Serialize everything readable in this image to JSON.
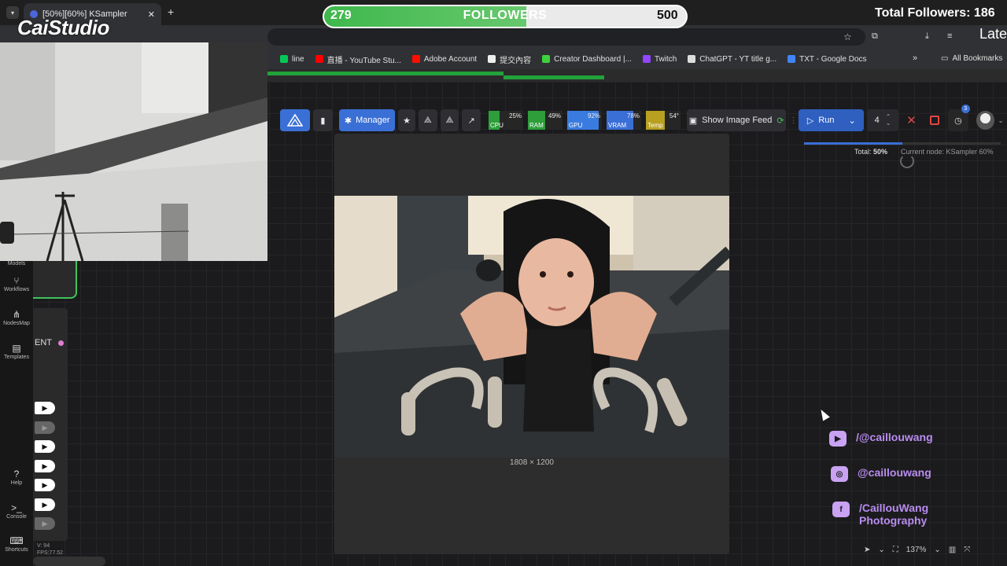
{
  "browser": {
    "tab_title": "[50%][60%] KSampler",
    "new_tab": "+",
    "close_tab": "✕",
    "bookmarks": [
      {
        "label": "line",
        "color": "#06c755"
      },
      {
        "label": "直播 - YouTube Stu...",
        "color": "#ff0000"
      },
      {
        "label": "Adobe Account",
        "color": "#fa0f00"
      },
      {
        "label": "提交內容",
        "color": "#eeeeee"
      },
      {
        "label": "Creator Dashboard |...",
        "color": "#3ed13e"
      },
      {
        "label": "Twitch",
        "color": "#9146ff"
      },
      {
        "label": "ChatGPT - YT title g...",
        "color": "#dddddd"
      },
      {
        "label": "TXT - Google Docs",
        "color": "#4285f4"
      }
    ],
    "more_bookmarks": "»",
    "all_bookmarks": "All Bookmarks"
  },
  "toolbar": {
    "manager_label": "Manager",
    "metrics": [
      {
        "label": "CPU",
        "percent": 25,
        "pct_text": "25%",
        "color": "#2e9e3a"
      },
      {
        "label": "RAM",
        "percent": 49,
        "pct_text": "49%",
        "color": "#2e9e3a"
      },
      {
        "label": "GPU",
        "percent": 92,
        "pct_text": "92%",
        "color": "#3a7be0"
      },
      {
        "label": "VRAM",
        "percent": 78,
        "pct_text": "78%",
        "color": "#3a6fd6"
      },
      {
        "label": "Temp",
        "percent": 54,
        "pct_text": "54°",
        "color": "#b8a020"
      }
    ],
    "show_image_feed": "Show Image Feed",
    "run_label": "Run",
    "batch_count": "4",
    "queue_badge": "3"
  },
  "run_status": {
    "total_label": "Total:",
    "total_value": "50%",
    "total_fraction": 0.5,
    "current_node": "Current node: KSampler 60%"
  },
  "image_panel": {
    "dimensions": "1808 × 1200"
  },
  "sidebar": {
    "items": [
      {
        "label": "Models",
        "icon": "⬚"
      },
      {
        "label": "Workflows",
        "icon": "⑂"
      },
      {
        "label": "NodesMap",
        "icon": "⋔"
      },
      {
        "label": "Templates",
        "icon": "▤"
      },
      {
        "label": "Help",
        "icon": "?"
      },
      {
        "label": "Console",
        "icon": ">_"
      },
      {
        "label": "Shortcuts",
        "icon": "⌨"
      }
    ]
  },
  "node": {
    "partial_label": "ENT"
  },
  "stats": {
    "line1": "V: 94",
    "line2": "FPS:77.52"
  },
  "overlay": {
    "brand": "CaiStudio",
    "followers_current": "279",
    "followers_title": "FOLLOWERS",
    "followers_goal": "500",
    "followers_fraction": 0.558,
    "total_followers": "Total Followers: 186",
    "late": "Late",
    "socials": [
      {
        "icon": "youtube-icon",
        "glyph": "▶",
        "text": "/@caillouwang"
      },
      {
        "icon": "instagram-icon",
        "glyph": "◎",
        "text": "@caillouwang"
      },
      {
        "icon": "facebook-icon",
        "glyph": "f",
        "text": "/CaillouWang Photography"
      }
    ]
  },
  "bottom_controls": {
    "zoom": "137%"
  }
}
